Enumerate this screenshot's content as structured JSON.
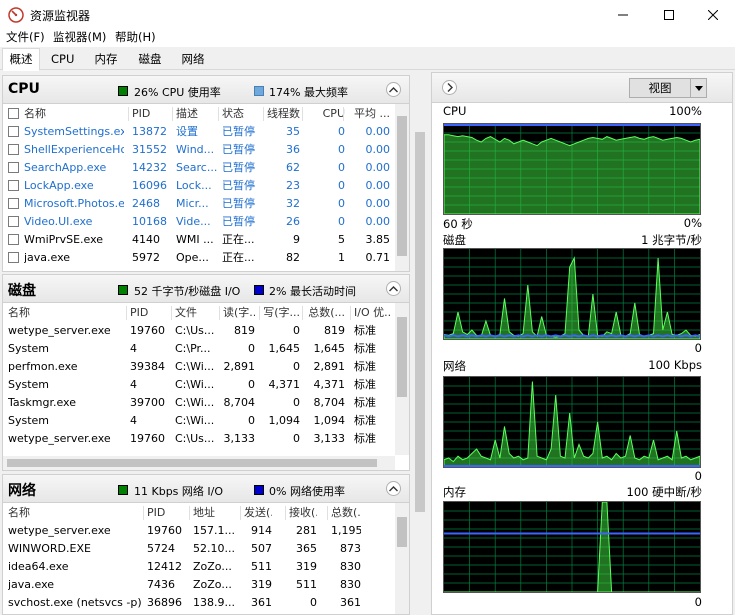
{
  "window": {
    "title": "资源监视器"
  },
  "menu": [
    "文件(F)",
    "监视器(M)",
    "帮助(H)"
  ],
  "tabs": [
    "概述",
    "CPU",
    "内存",
    "磁盘",
    "网络"
  ],
  "cpu": {
    "title": "CPU",
    "legend1": "26% CPU 使用率",
    "legend2": "174% 最大频率",
    "legend1_color": "#008000",
    "legend2_color": "#6fa8dc",
    "columns": [
      "名称",
      "PID",
      "描述",
      "状态",
      "线程数",
      "CPU",
      "平均 ..."
    ],
    "rows": [
      {
        "name": "SystemSettings.exe",
        "pid": "13872",
        "desc": "设置",
        "status": "已暂停",
        "threads": "35",
        "cpu": "0",
        "avg": "0.00",
        "suspended": true
      },
      {
        "name": "ShellExperienceHos...",
        "pid": "31552",
        "desc": "Wind...",
        "status": "已暂停",
        "threads": "36",
        "cpu": "0",
        "avg": "0.00",
        "suspended": true
      },
      {
        "name": "SearchApp.exe",
        "pid": "14232",
        "desc": "Searc...",
        "status": "已暂停",
        "threads": "62",
        "cpu": "0",
        "avg": "0.00",
        "suspended": true
      },
      {
        "name": "LockApp.exe",
        "pid": "16096",
        "desc": "Lock...",
        "status": "已暂停",
        "threads": "23",
        "cpu": "0",
        "avg": "0.00",
        "suspended": true
      },
      {
        "name": "Microsoft.Photos.exe",
        "pid": "2468",
        "desc": "Micr...",
        "status": "已暂停",
        "threads": "32",
        "cpu": "0",
        "avg": "0.00",
        "suspended": true
      },
      {
        "name": "Video.UI.exe",
        "pid": "10168",
        "desc": "Vide...",
        "status": "已暂停",
        "threads": "26",
        "cpu": "0",
        "avg": "0.00",
        "suspended": true
      },
      {
        "name": "WmiPrvSE.exe",
        "pid": "4140",
        "desc": "WMI ...",
        "status": "正在...",
        "threads": "9",
        "cpu": "5",
        "avg": "3.85",
        "suspended": false
      },
      {
        "name": "java.exe",
        "pid": "5972",
        "desc": "Ope...",
        "status": "正在...",
        "threads": "82",
        "cpu": "1",
        "avg": "0.71",
        "suspended": false
      }
    ]
  },
  "disk": {
    "title": "磁盘",
    "legend1": "52 千字节/秒磁盘 I/O",
    "legend2": "2% 最长活动时间",
    "legend1_color": "#008000",
    "legend2_color": "#0000cc",
    "columns": [
      "名称",
      "PID",
      "文件",
      "读(字...",
      "写(字...",
      "总数(...",
      "I/O 优..."
    ],
    "rows": [
      {
        "name": "wetype_server.exe",
        "pid": "19760",
        "file": "C:\\Us...",
        "read": "819",
        "write": "0",
        "total": "819",
        "prio": "标准"
      },
      {
        "name": "System",
        "pid": "4",
        "file": "C:\\Pr...",
        "read": "0",
        "write": "1,645",
        "total": "1,645",
        "prio": "标准"
      },
      {
        "name": "perfmon.exe",
        "pid": "39384",
        "file": "C:\\Wi...",
        "read": "2,891",
        "write": "0",
        "total": "2,891",
        "prio": "标准"
      },
      {
        "name": "System",
        "pid": "4",
        "file": "C:\\Wi...",
        "read": "0",
        "write": "4,371",
        "total": "4,371",
        "prio": "标准"
      },
      {
        "name": "Taskmgr.exe",
        "pid": "39700",
        "file": "C:\\Wi...",
        "read": "8,704",
        "write": "0",
        "total": "8,704",
        "prio": "标准"
      },
      {
        "name": "System",
        "pid": "4",
        "file": "C:\\Wi...",
        "read": "0",
        "write": "1,094",
        "total": "1,094",
        "prio": "标准"
      },
      {
        "name": "wetype_server.exe",
        "pid": "19760",
        "file": "C:\\Us...",
        "read": "3,133",
        "write": "0",
        "total": "3,133",
        "prio": "标准"
      }
    ]
  },
  "network": {
    "title": "网络",
    "legend1": "11 Kbps 网络 I/O",
    "legend2": "0% 网络使用率",
    "legend1_color": "#008000",
    "legend2_color": "#0000cc",
    "columns": [
      "名称",
      "PID",
      "地址",
      "发送(...",
      "接收(...",
      "总数(..."
    ],
    "rows": [
      {
        "name": "wetype_server.exe",
        "pid": "19760",
        "addr": "157.1...",
        "sent": "914",
        "recv": "281",
        "total": "1,195"
      },
      {
        "name": "WINWORD.EXE",
        "pid": "5724",
        "addr": "52.10...",
        "sent": "507",
        "recv": "365",
        "total": "873"
      },
      {
        "name": "idea64.exe",
        "pid": "12412",
        "addr": "ZoZo...",
        "sent": "511",
        "recv": "319",
        "total": "830"
      },
      {
        "name": "java.exe",
        "pid": "7436",
        "addr": "ZoZo...",
        "sent": "319",
        "recv": "511",
        "total": "830"
      },
      {
        "name": "svchost.exe (netsvcs -p)",
        "pid": "36896",
        "addr": "138.9...",
        "sent": "361",
        "recv": "0",
        "total": "361"
      }
    ]
  },
  "right": {
    "view_label": "视图",
    "graphs": [
      {
        "key": "cpu",
        "title": "CPU",
        "max": "100%",
        "left_bottom": "60 秒",
        "right_bottom": "0%",
        "data": [
          88,
          88,
          87,
          86,
          87,
          86,
          85,
          82,
          80,
          84,
          86,
          83,
          80,
          84,
          82,
          78,
          80,
          82,
          80,
          78,
          76,
          80,
          82,
          84,
          82,
          80,
          78,
          76,
          78,
          80,
          82,
          84,
          85,
          84,
          83,
          86,
          84,
          82,
          83,
          84,
          85,
          86,
          84,
          83,
          85,
          86,
          84,
          82,
          83,
          84,
          85,
          84,
          82,
          80,
          82,
          83
        ],
        "data2": [
          100,
          100,
          100,
          100,
          100,
          100,
          100,
          100,
          100,
          100,
          100,
          100,
          100,
          100,
          100,
          100,
          100,
          100,
          100,
          100,
          100,
          100,
          100,
          100,
          100,
          100,
          100,
          100,
          100,
          100,
          100,
          100,
          100,
          100,
          100,
          100,
          100,
          100,
          100,
          100,
          100,
          100,
          100,
          100,
          100,
          100,
          100,
          100,
          100,
          100,
          100,
          100,
          100,
          100,
          100,
          100
        ]
      },
      {
        "key": "disk",
        "title": "磁盘",
        "max": "1 兆字节/秒",
        "left_bottom": "",
        "right_bottom": "0",
        "data": [
          5,
          4,
          6,
          30,
          8,
          5,
          10,
          4,
          3,
          20,
          4,
          3,
          5,
          45,
          8,
          4,
          3,
          6,
          60,
          8,
          3,
          25,
          4,
          3,
          2,
          3,
          6,
          80,
          90,
          10,
          4,
          3,
          50,
          4,
          3,
          8,
          6,
          30,
          4,
          3,
          6,
          40,
          5,
          3,
          4,
          6,
          90,
          10,
          30,
          5,
          4,
          6,
          10,
          4,
          3,
          5
        ],
        "data2": [
          4,
          3,
          4,
          3,
          4,
          3,
          4,
          3,
          4,
          3,
          4,
          3,
          4,
          3,
          4,
          3,
          4,
          3,
          4,
          3,
          4,
          3,
          4,
          3,
          4,
          3,
          4,
          3,
          4,
          3,
          4,
          3,
          4,
          3,
          4,
          3,
          4,
          3,
          4,
          3,
          4,
          3,
          4,
          3,
          4,
          3,
          4,
          3,
          4,
          3,
          4,
          3,
          4,
          3,
          4,
          3
        ]
      },
      {
        "key": "net",
        "title": "网络",
        "max": "100 Kbps",
        "left_bottom": "",
        "right_bottom": "0",
        "data": [
          8,
          10,
          6,
          12,
          8,
          10,
          15,
          20,
          12,
          10,
          8,
          30,
          10,
          45,
          15,
          10,
          12,
          8,
          10,
          95,
          12,
          10,
          8,
          20,
          80,
          12,
          10,
          60,
          10,
          25,
          12,
          10,
          15,
          50,
          10,
          12,
          8,
          15,
          10,
          12,
          35,
          10,
          8,
          12,
          10,
          30,
          8,
          10,
          12,
          8,
          40,
          10,
          12,
          8,
          10,
          12
        ],
        "data2": [
          1,
          1,
          1,
          1,
          1,
          1,
          1,
          1,
          1,
          1,
          1,
          1,
          1,
          1,
          1,
          1,
          1,
          1,
          1,
          1,
          1,
          1,
          1,
          1,
          1,
          1,
          1,
          1,
          1,
          1,
          1,
          1,
          1,
          1,
          1,
          1,
          1,
          1,
          1,
          1,
          1,
          1,
          1,
          1,
          1,
          1,
          1,
          1,
          1,
          1,
          1,
          1,
          1,
          1,
          1,
          1
        ]
      },
      {
        "key": "mem",
        "title": "内存",
        "max": "100 硬中断/秒",
        "left_bottom": "",
        "right_bottom": "0",
        "data": [
          0,
          0,
          0,
          0,
          0,
          0,
          0,
          0,
          0,
          0,
          0,
          0,
          0,
          0,
          0,
          0,
          0,
          0,
          0,
          0,
          0,
          0,
          0,
          0,
          0,
          0,
          0,
          0,
          0,
          0,
          0,
          0,
          0,
          0,
          100,
          100,
          0,
          0,
          0,
          0,
          0,
          0,
          0,
          0,
          0,
          0,
          0,
          0,
          0,
          0,
          0,
          0,
          0,
          0,
          0,
          0
        ],
        "data2": [
          65,
          65,
          65,
          65,
          65,
          65,
          65,
          65,
          65,
          65,
          65,
          65,
          65,
          65,
          65,
          65,
          65,
          65,
          65,
          65,
          65,
          65,
          65,
          65,
          65,
          65,
          65,
          65,
          65,
          65,
          65,
          65,
          65,
          65,
          65,
          65,
          65,
          65,
          65,
          65,
          65,
          65,
          65,
          65,
          65,
          65,
          65,
          65,
          65,
          65,
          65,
          65,
          65,
          65,
          65,
          65
        ]
      }
    ]
  }
}
